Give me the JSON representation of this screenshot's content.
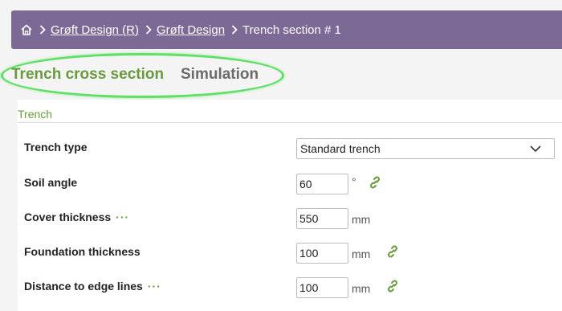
{
  "breadcrumb": {
    "home_icon": "home-icon",
    "items": [
      {
        "label": "Grøft Design (R)",
        "link": true
      },
      {
        "label": "Grøft Design",
        "link": true
      },
      {
        "label": "Trench section # 1",
        "link": false
      }
    ]
  },
  "tabs": [
    {
      "label": "Trench cross section",
      "active": true
    },
    {
      "label": "Simulation",
      "active": false
    }
  ],
  "section": {
    "title": "Trench"
  },
  "fields": {
    "trench_type": {
      "label": "Trench type",
      "value": "Standard trench"
    },
    "soil_angle": {
      "label": "Soil angle",
      "value": "60",
      "unit": "°"
    },
    "cover_thickness": {
      "label": "Cover thickness",
      "value": "550",
      "unit": "mm"
    },
    "foundation_thickness": {
      "label": "Foundation thickness",
      "value": "100",
      "unit": "mm"
    },
    "distance_edge": {
      "label": "Distance to edge lines",
      "value": "100",
      "unit": "mm"
    }
  },
  "more_indicator": "···",
  "colors": {
    "header": "#7d6995",
    "accent_green": "#6a9a3e",
    "highlight": "#5fe065"
  }
}
